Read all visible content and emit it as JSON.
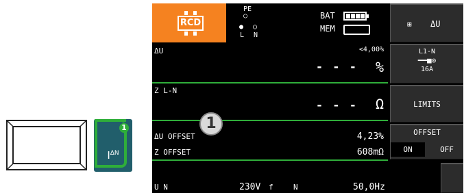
{
  "key_button": {
    "label": ""
  },
  "idn_button": {
    "badge": "1",
    "label_i": "I",
    "label_sub": "ΔN"
  },
  "header": {
    "mode": "RCD",
    "pe_label": "PE",
    "conn_l": "L",
    "conn_n": "N",
    "bat_label": "BAT",
    "mem_label": "MEM"
  },
  "rows": {
    "du": {
      "label": "ΔU",
      "limit": "<4,00%",
      "value": "- - -",
      "unit": "%"
    },
    "zln": {
      "label": "Z L-N",
      "value": "- - -",
      "unit": "Ω"
    },
    "du_offset": {
      "label": "ΔU OFFSET",
      "value": "4,23%"
    },
    "z_offset": {
      "label": "Z OFFSET",
      "value": "608mΩ"
    }
  },
  "status_bar": {
    "un_label": "U N",
    "un_value": "230V",
    "f_label": "f",
    "n_label": "N",
    "f_value": "50,0Hz"
  },
  "sidebar": {
    "du_button": "ΔU",
    "ln_label": "L1-N",
    "ln_current": "16A",
    "limits": "LIMITS",
    "offset": "OFFSET",
    "on": "ON",
    "off": "OFF"
  },
  "callout": "1",
  "colors": {
    "accent": "#f58220",
    "green": "#2fae3a",
    "teal": "#215e6b"
  }
}
